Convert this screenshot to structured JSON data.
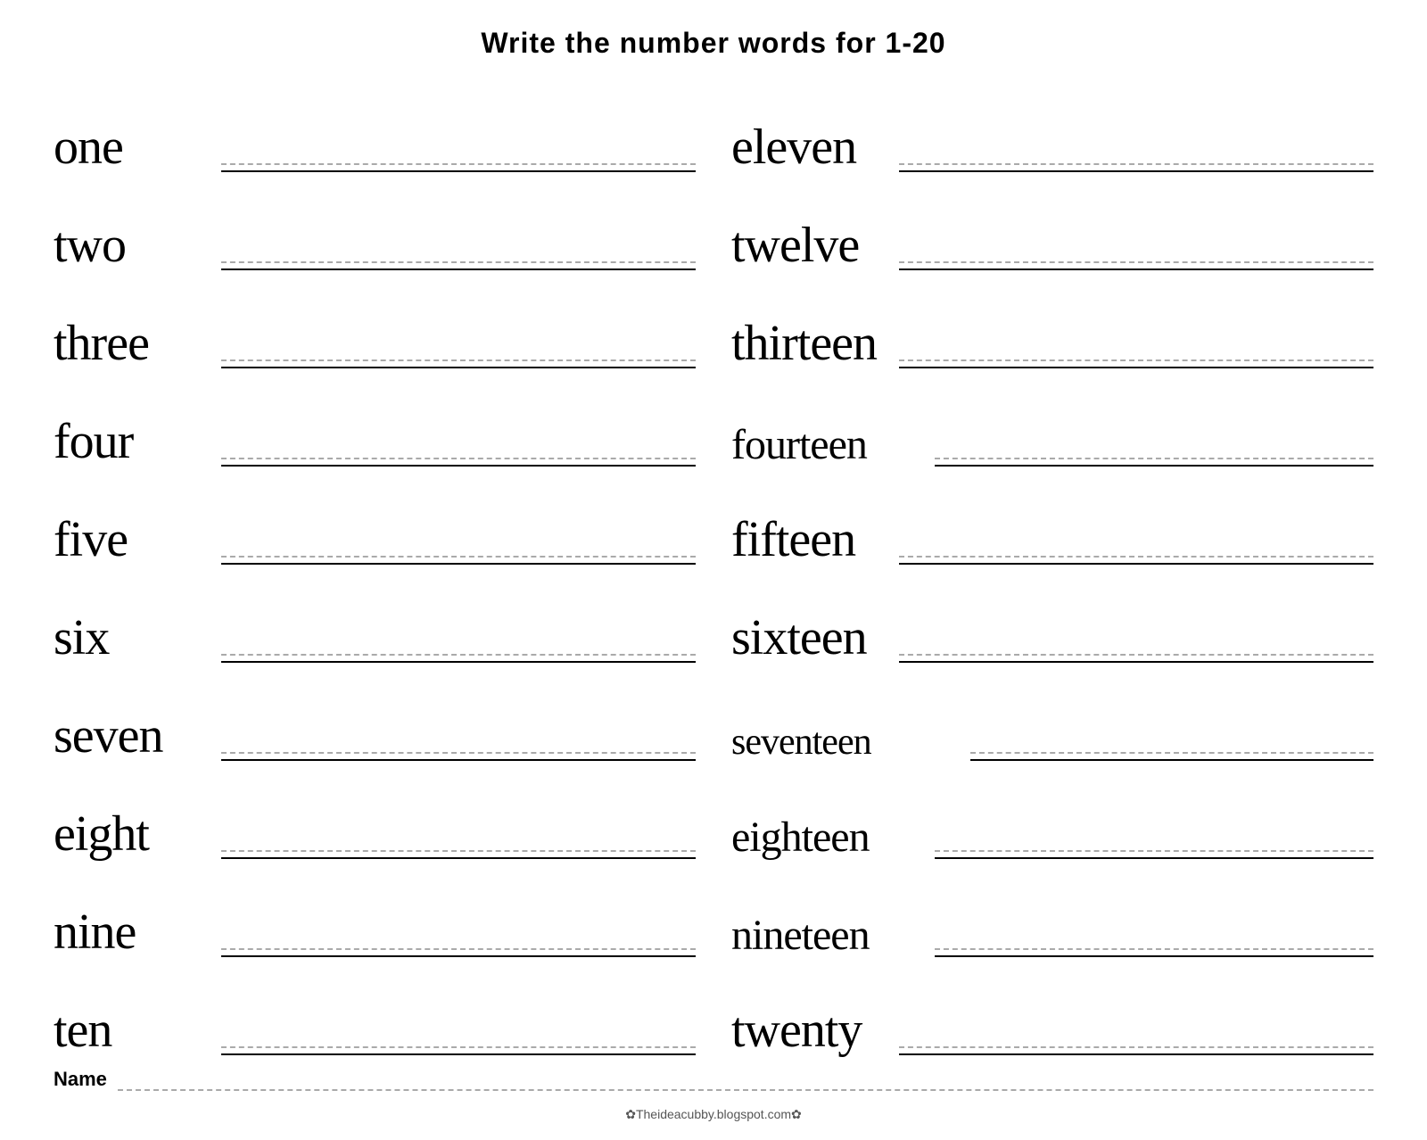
{
  "title": "Write the number words for  1-20",
  "left_words": [
    {
      "word": "one",
      "size": "normal"
    },
    {
      "word": "two",
      "size": "normal"
    },
    {
      "word": "three",
      "size": "normal"
    },
    {
      "word": "four",
      "size": "normal"
    },
    {
      "word": "five",
      "size": "normal"
    },
    {
      "word": "six",
      "size": "normal"
    },
    {
      "word": "seven",
      "size": "normal"
    },
    {
      "word": "eight",
      "size": "normal"
    },
    {
      "word": "nine",
      "size": "normal"
    },
    {
      "word": "ten",
      "size": "normal"
    }
  ],
  "right_words": [
    {
      "word": "eleven",
      "size": "normal"
    },
    {
      "word": "twelve",
      "size": "normal"
    },
    {
      "word": "thirteen",
      "size": "normal"
    },
    {
      "word": "fourteen",
      "size": "large"
    },
    {
      "word": "fifteen",
      "size": "normal"
    },
    {
      "word": "sixteen",
      "size": "normal"
    },
    {
      "word": "seventeen",
      "size": "xlarge"
    },
    {
      "word": "eighteen",
      "size": "large"
    },
    {
      "word": "nineteen",
      "size": "large"
    },
    {
      "word": "twenty",
      "size": "normal"
    }
  ],
  "name_label": "Name",
  "footer": "✿Theideacubby.blogspot.com✿"
}
